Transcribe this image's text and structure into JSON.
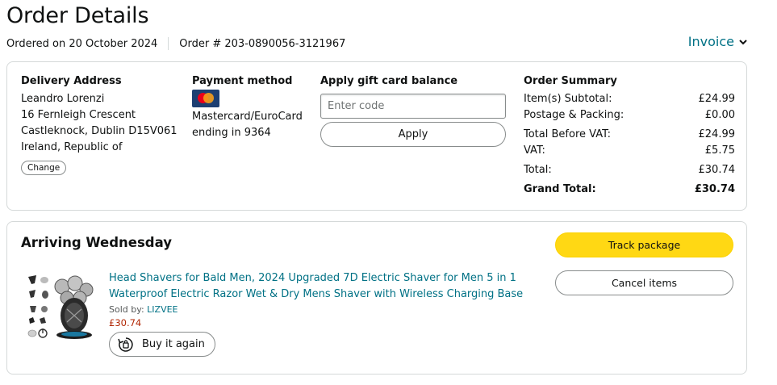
{
  "header": {
    "title": "Order Details",
    "ordered_on": "Ordered on 20 October 2024",
    "order_number": "Order # 203-0890056-3121967",
    "invoice_label": "Invoice"
  },
  "delivery": {
    "title": "Delivery Address",
    "lines": [
      "Leandro Lorenzi",
      "16 Fernleigh Crescent",
      "Castleknock, Dublin D15V061",
      "Ireland, Republic of"
    ],
    "change_label": "Change"
  },
  "payment": {
    "title": "Payment method",
    "card_icon": "mastercard-icon",
    "lines": [
      "Mastercard/EuroCard",
      "ending in 9364"
    ]
  },
  "gift": {
    "title": "Apply gift card balance",
    "placeholder": "Enter code",
    "value": "",
    "apply_label": "Apply"
  },
  "summary": {
    "title": "Order Summary",
    "rows": [
      {
        "label": "Item(s) Subtotal:",
        "value": "£24.99"
      },
      {
        "label": "Postage & Packing:",
        "value": "£0.00"
      },
      {
        "label": "Total Before VAT:",
        "value": "£24.99"
      },
      {
        "label": "VAT:",
        "value": "£5.75"
      },
      {
        "label": "Total:",
        "value": "£30.74"
      },
      {
        "label": "Grand Total:",
        "value": "£30.74"
      }
    ]
  },
  "shipment": {
    "status": "Arriving Wednesday",
    "track_label": "Track package",
    "cancel_label": "Cancel items",
    "item": {
      "title": "Head Shavers for Bald Men, 2024 Upgraded 7D Electric Shaver for Men 5 in 1 Waterproof Electric Razor Wet & Dry Mens Shaver with Wireless Charging Base",
      "sold_by_label": "Sold by: ",
      "seller": "LIZVEE",
      "price": "£30.74",
      "buy_again_label": "Buy it again"
    }
  },
  "colors": {
    "link": "#007185",
    "price": "#b12704",
    "primary_button": "#ffd814",
    "border": "#d5d9d9"
  }
}
